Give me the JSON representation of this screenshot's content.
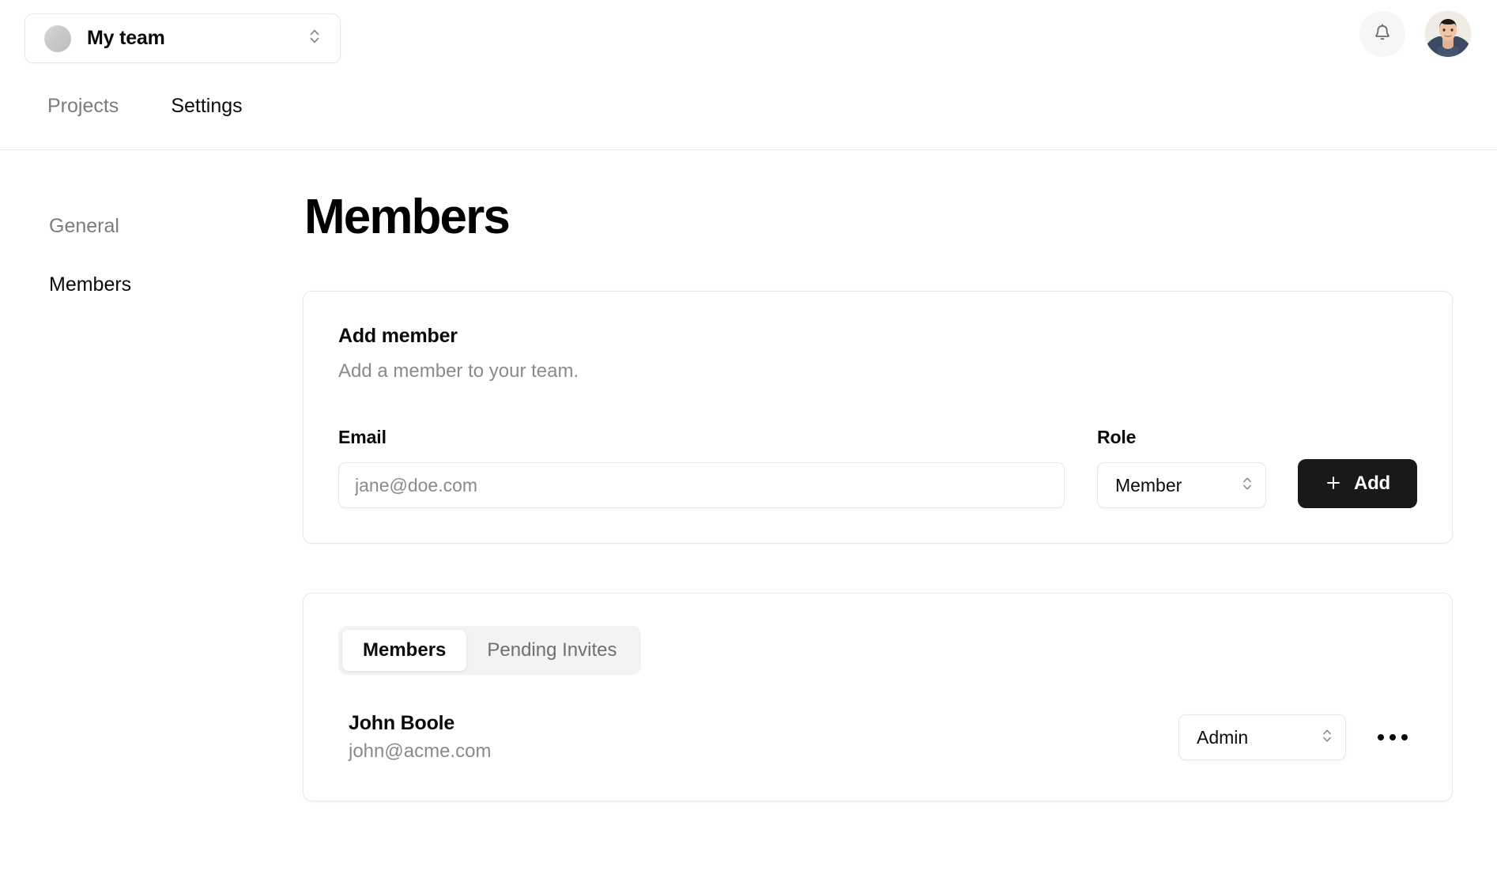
{
  "topbar": {
    "team_switcher": {
      "team_name": "My team",
      "avatar_icon": "team-avatar-circle",
      "chevron_icon": "chevron-up-down-icon"
    },
    "nav": [
      {
        "label": "Projects",
        "active": false
      },
      {
        "label": "Settings",
        "active": true
      }
    ],
    "notifications_icon": "bell-icon",
    "user_avatar_icon": "user-avatar-photo"
  },
  "sidenav": {
    "items": [
      {
        "label": "General",
        "active": false
      },
      {
        "label": "Members",
        "active": true
      }
    ]
  },
  "main": {
    "page_title": "Members",
    "add_member_card": {
      "title": "Add member",
      "subtitle": "Add a member to your team.",
      "email_label": "Email",
      "email_placeholder": "jane@doe.com",
      "email_value": "",
      "role_label": "Role",
      "role_value": "Member",
      "role_chevron_icon": "chevron-up-down-icon",
      "add_button_label": "Add",
      "add_button_icon": "plus-icon"
    },
    "members_card": {
      "tabs": [
        {
          "label": "Members",
          "active": true
        },
        {
          "label": "Pending Invites",
          "active": false
        }
      ],
      "rows": [
        {
          "name": "John Boole",
          "email": "john@acme.com",
          "role": "Admin",
          "role_chevron_icon": "chevron-up-down-icon",
          "more_icon": "ellipsis-horizontal-icon"
        }
      ]
    }
  },
  "colors": {
    "accent_dark": "#191919",
    "text_primary": "#0a0a0a",
    "text_muted": "#8a8a8a",
    "border": "#e8e8e8",
    "segment_bg": "#f3f3f3"
  }
}
